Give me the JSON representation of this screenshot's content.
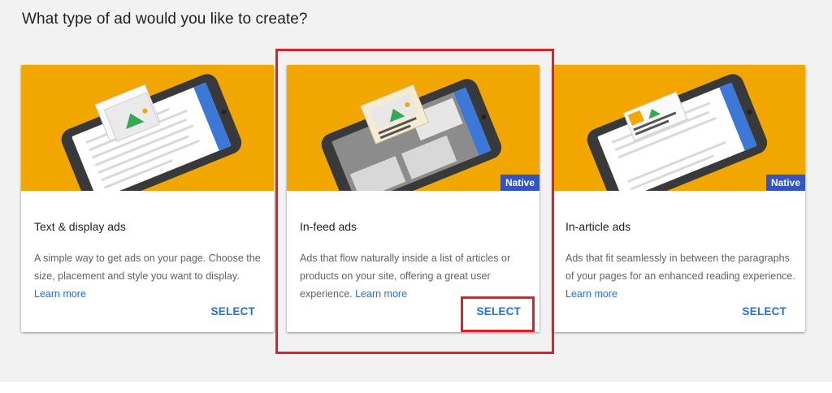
{
  "page": {
    "title": "What type of ad would you like to create?"
  },
  "cards": [
    {
      "title": "Text & display ads",
      "description": "A simple way to get ads on your page. Choose the size, placement and style you want to display.",
      "learn_more": "Learn more",
      "select_label": "SELECT",
      "badge": ""
    },
    {
      "title": "In-feed ads",
      "description": "Ads that flow naturally inside a list of articles or products on your site, offering a great user experience.",
      "learn_more": "Learn more",
      "select_label": "SELECT",
      "badge": "Native"
    },
    {
      "title": "In-article ads",
      "description": "Ads that fit seamlessly in between the paragraphs of your pages for an enhanced reading experience.",
      "learn_more": "Learn more",
      "select_label": "SELECT",
      "badge": "Native"
    }
  ],
  "colors": {
    "image_background": "#f2a600",
    "badge_background": "#2f55c7",
    "link": "#1a73e8",
    "highlight": "#e0202a"
  },
  "highlight": {
    "card_index": 1,
    "select_index": 1
  }
}
